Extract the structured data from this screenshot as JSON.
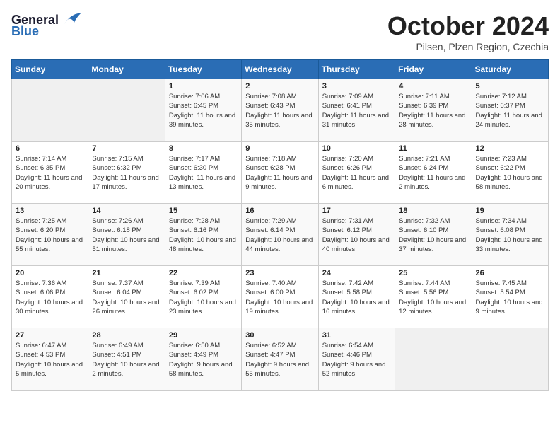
{
  "header": {
    "logo_general": "General",
    "logo_blue": "Blue",
    "month": "October 2024",
    "location": "Pilsen, Plzen Region, Czechia"
  },
  "weekdays": [
    "Sunday",
    "Monday",
    "Tuesday",
    "Wednesday",
    "Thursday",
    "Friday",
    "Saturday"
  ],
  "weeks": [
    [
      {
        "day": "",
        "info": ""
      },
      {
        "day": "",
        "info": ""
      },
      {
        "day": "1",
        "info": "Sunrise: 7:06 AM\nSunset: 6:45 PM\nDaylight: 11 hours and 39 minutes."
      },
      {
        "day": "2",
        "info": "Sunrise: 7:08 AM\nSunset: 6:43 PM\nDaylight: 11 hours and 35 minutes."
      },
      {
        "day": "3",
        "info": "Sunrise: 7:09 AM\nSunset: 6:41 PM\nDaylight: 11 hours and 31 minutes."
      },
      {
        "day": "4",
        "info": "Sunrise: 7:11 AM\nSunset: 6:39 PM\nDaylight: 11 hours and 28 minutes."
      },
      {
        "day": "5",
        "info": "Sunrise: 7:12 AM\nSunset: 6:37 PM\nDaylight: 11 hours and 24 minutes."
      }
    ],
    [
      {
        "day": "6",
        "info": "Sunrise: 7:14 AM\nSunset: 6:35 PM\nDaylight: 11 hours and 20 minutes."
      },
      {
        "day": "7",
        "info": "Sunrise: 7:15 AM\nSunset: 6:32 PM\nDaylight: 11 hours and 17 minutes."
      },
      {
        "day": "8",
        "info": "Sunrise: 7:17 AM\nSunset: 6:30 PM\nDaylight: 11 hours and 13 minutes."
      },
      {
        "day": "9",
        "info": "Sunrise: 7:18 AM\nSunset: 6:28 PM\nDaylight: 11 hours and 9 minutes."
      },
      {
        "day": "10",
        "info": "Sunrise: 7:20 AM\nSunset: 6:26 PM\nDaylight: 11 hours and 6 minutes."
      },
      {
        "day": "11",
        "info": "Sunrise: 7:21 AM\nSunset: 6:24 PM\nDaylight: 11 hours and 2 minutes."
      },
      {
        "day": "12",
        "info": "Sunrise: 7:23 AM\nSunset: 6:22 PM\nDaylight: 10 hours and 58 minutes."
      }
    ],
    [
      {
        "day": "13",
        "info": "Sunrise: 7:25 AM\nSunset: 6:20 PM\nDaylight: 10 hours and 55 minutes."
      },
      {
        "day": "14",
        "info": "Sunrise: 7:26 AM\nSunset: 6:18 PM\nDaylight: 10 hours and 51 minutes."
      },
      {
        "day": "15",
        "info": "Sunrise: 7:28 AM\nSunset: 6:16 PM\nDaylight: 10 hours and 48 minutes."
      },
      {
        "day": "16",
        "info": "Sunrise: 7:29 AM\nSunset: 6:14 PM\nDaylight: 10 hours and 44 minutes."
      },
      {
        "day": "17",
        "info": "Sunrise: 7:31 AM\nSunset: 6:12 PM\nDaylight: 10 hours and 40 minutes."
      },
      {
        "day": "18",
        "info": "Sunrise: 7:32 AM\nSunset: 6:10 PM\nDaylight: 10 hours and 37 minutes."
      },
      {
        "day": "19",
        "info": "Sunrise: 7:34 AM\nSunset: 6:08 PM\nDaylight: 10 hours and 33 minutes."
      }
    ],
    [
      {
        "day": "20",
        "info": "Sunrise: 7:36 AM\nSunset: 6:06 PM\nDaylight: 10 hours and 30 minutes."
      },
      {
        "day": "21",
        "info": "Sunrise: 7:37 AM\nSunset: 6:04 PM\nDaylight: 10 hours and 26 minutes."
      },
      {
        "day": "22",
        "info": "Sunrise: 7:39 AM\nSunset: 6:02 PM\nDaylight: 10 hours and 23 minutes."
      },
      {
        "day": "23",
        "info": "Sunrise: 7:40 AM\nSunset: 6:00 PM\nDaylight: 10 hours and 19 minutes."
      },
      {
        "day": "24",
        "info": "Sunrise: 7:42 AM\nSunset: 5:58 PM\nDaylight: 10 hours and 16 minutes."
      },
      {
        "day": "25",
        "info": "Sunrise: 7:44 AM\nSunset: 5:56 PM\nDaylight: 10 hours and 12 minutes."
      },
      {
        "day": "26",
        "info": "Sunrise: 7:45 AM\nSunset: 5:54 PM\nDaylight: 10 hours and 9 minutes."
      }
    ],
    [
      {
        "day": "27",
        "info": "Sunrise: 6:47 AM\nSunset: 4:53 PM\nDaylight: 10 hours and 5 minutes."
      },
      {
        "day": "28",
        "info": "Sunrise: 6:49 AM\nSunset: 4:51 PM\nDaylight: 10 hours and 2 minutes."
      },
      {
        "day": "29",
        "info": "Sunrise: 6:50 AM\nSunset: 4:49 PM\nDaylight: 9 hours and 58 minutes."
      },
      {
        "day": "30",
        "info": "Sunrise: 6:52 AM\nSunset: 4:47 PM\nDaylight: 9 hours and 55 minutes."
      },
      {
        "day": "31",
        "info": "Sunrise: 6:54 AM\nSunset: 4:46 PM\nDaylight: 9 hours and 52 minutes."
      },
      {
        "day": "",
        "info": ""
      },
      {
        "day": "",
        "info": ""
      }
    ]
  ]
}
